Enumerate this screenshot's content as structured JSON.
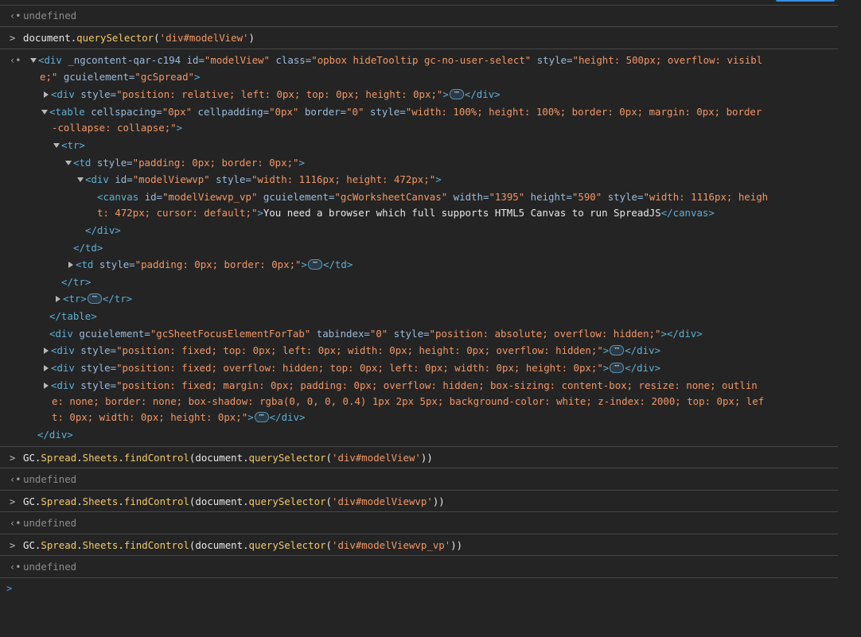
{
  "undefined_text": "undefined",
  "cmd1": {
    "obj": "document",
    "dot": ".",
    "fn": "querySelector",
    "open": "(",
    "arg": "'div#modelView'",
    "close": ")"
  },
  "html": {
    "l1": {
      "open": "<div",
      "a1": "_ngcontent-qar-c194",
      "a2n": "id",
      "eq": "=",
      "a2v": "\"modelView\"",
      "a3n": "class",
      "a3v": "\"opbox hideTooltip gc-no-user-select\"",
      "a4n": "style",
      "a4v": "\"height: 500px; overflow: visibl"
    },
    "l2": {
      "a4v_cont": "e;\"",
      "a5n": "gcuielement",
      "a5v": "\"gcSpread\"",
      "close": ">"
    },
    "l3": {
      "open": "<div",
      "a1n": "style",
      "a1v": "\"position: relative; left: 0px; top: 0px; height: 0px;\"",
      "close": ">",
      "end": "</div>"
    },
    "l4": {
      "open": "<table",
      "a1n": "cellspacing",
      "a1v": "\"0px\"",
      "a2n": "cellpadding",
      "a2v": "\"0px\"",
      "a3n": "border",
      "a3v": "\"0\"",
      "a4n": "style",
      "a4v": "\"width: 100%; height: 100%; border: 0px; margin: 0px; border"
    },
    "l5": {
      "a4v_cont": "-collapse: collapse;\"",
      "close": ">"
    },
    "l6": {
      "tag": "<tr>"
    },
    "l7": {
      "open": "<td",
      "a1n": "style",
      "a1v": "\"padding: 0px; border: 0px;\"",
      "close": ">"
    },
    "l8": {
      "open": "<div",
      "a1n": "id",
      "a1v": "\"modelViewvp\"",
      "a2n": "style",
      "a2v": "\"width: 1116px; height: 472px;\"",
      "close": ">"
    },
    "l9": {
      "open": "<canvas",
      "a1n": "id",
      "a1v": "\"modelViewvp_vp\"",
      "a2n": "gcuielement",
      "a2v": "\"gcWorksheetCanvas\"",
      "a3n": "width",
      "a3v": "\"1395\"",
      "a4n": "height",
      "a4v": "\"590\"",
      "a5n": "style",
      "a5v": "\"width: 1116px; heigh"
    },
    "l10": {
      "a5v_cont": "t: 472px; cursor: default;\"",
      "close": ">",
      "text": "You need a browser which full supports HTML5 Canvas to run SpreadJS",
      "end": "</canvas>"
    },
    "l11": {
      "tag": "</div>"
    },
    "l12": {
      "tag": "</td>"
    },
    "l13": {
      "open": "<td",
      "a1n": "style",
      "a1v": "\"padding: 0px; border: 0px;\"",
      "close": ">",
      "end": "</td>"
    },
    "l14": {
      "tag": "</tr>"
    },
    "l15": {
      "open": "<tr>",
      "end": "</tr>"
    },
    "l16": {
      "tag": "</table>"
    },
    "l17": {
      "open": "<div",
      "a1n": "gcuielement",
      "a1v": "\"gcSheetFocusElementForTab\"",
      "a2n": "tabindex",
      "a2v": "\"0\"",
      "a3n": "style",
      "a3v": "\"position: absolute; overflow: hidden;\"",
      "close": ">",
      "end": "</div>"
    },
    "l18": {
      "open": "<div",
      "a1n": "style",
      "a1v": "\"position: fixed; top: 0px; left: 0px; width: 0px; height: 0px; overflow: hidden;\"",
      "close": ">",
      "end": "</div>"
    },
    "l19": {
      "open": "<div",
      "a1n": "style",
      "a1v": "\"position: fixed; overflow: hidden; top: 0px; left: 0px; width: 0px; height: 0px;\"",
      "close": ">",
      "end": "</div>"
    },
    "l20": {
      "open": "<div",
      "a1n": "style",
      "a1v": "\"position: fixed; margin: 0px; padding: 0px; overflow: hidden; box-sizing: content-box; resize: none; outlin"
    },
    "l21": {
      "a1v_cont": "e: none; border: none; box-shadow: rgba(0, 0, 0, 0.4) 1px 2px 5px; background-color: white; z-index: 2000; top: 0px; lef"
    },
    "l22": {
      "a1v_cont": "t: 0px; width: 0px; height: 0px;\"",
      "close": ">",
      "end": "</div>"
    },
    "l23": {
      "tag": "</div>"
    }
  },
  "cmd2": {
    "p1": "GC",
    "dot": ".",
    "p2": "Spread",
    "p3": "Sheets",
    "fn1": "findControl",
    "open": "(",
    "obj": "document",
    "fn2": "querySelector",
    "arg": "'div#modelView'",
    "close": "))"
  },
  "cmd3": {
    "arg": "'div#modelViewvp'"
  },
  "cmd4": {
    "arg": "'div#modelViewvp_vp'"
  },
  "ellipsis": "⋯"
}
